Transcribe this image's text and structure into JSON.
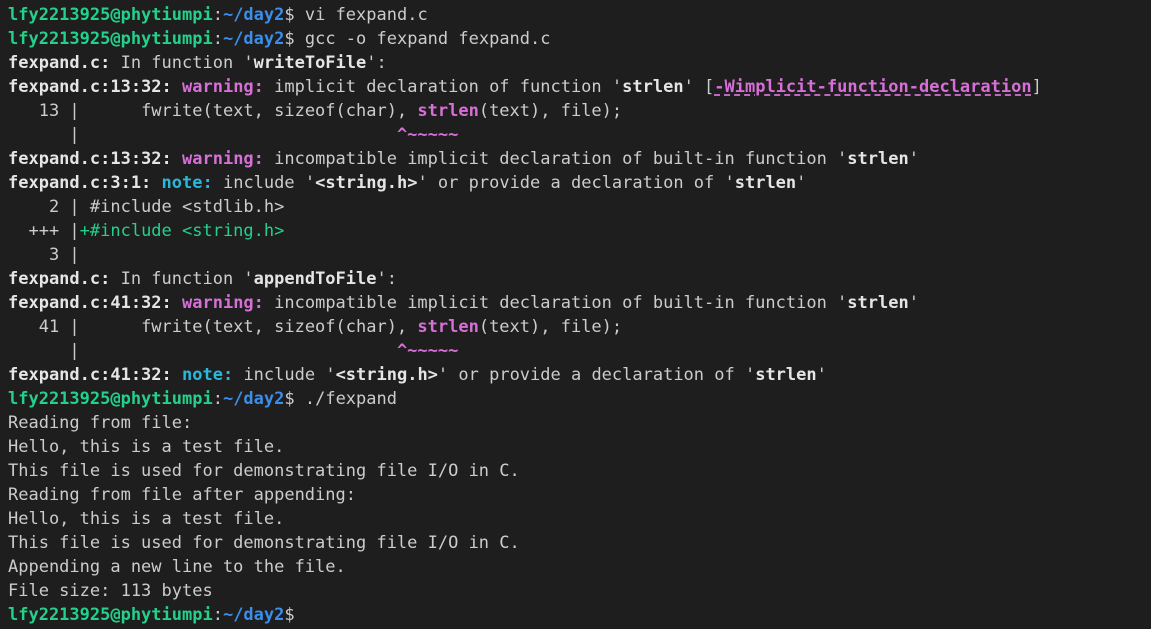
{
  "terminal": {
    "prompt_user_host": "lfy2213925@phytiumpi",
    "prompt_colon": ":",
    "prompt_path": "~/day2",
    "prompt_dollar": "$",
    "cmd1": " vi fexpand.c",
    "cmd2": " gcc -o fexpand fexpand.c",
    "cmd3": " ./fexpand",
    "l3_file": "fexpand.c:",
    "l3_text": " In function '",
    "l3_func": "writeToFile",
    "l3_end": "':",
    "l4_loc": "fexpand.c:13:32:",
    "l4_sp": " ",
    "l4_kind": "warning:",
    "l4_text": " implicit declaration of function '",
    "l4_sym": "strlen",
    "l4_mid": "' [",
    "l4_flag": "-Wimplicit-function-declaration",
    "l4_end": "]",
    "l5_gutter": "   13 |     ",
    "l5_code_a": " fwrite(text, sizeof(char), ",
    "l5_code_sym": "strlen",
    "l5_code_b": "(text), file);",
    "l6_gutter": "      |",
    "l6_pad": "                               ",
    "l6_caret": "^~~~~~",
    "l7_loc": "fexpand.c:13:32:",
    "l7_sp": " ",
    "l7_kind": "warning:",
    "l7_text": " incompatible implicit declaration of built-in function '",
    "l7_sym": "strlen",
    "l7_end": "'",
    "l8_loc": "fexpand.c:3:1:",
    "l8_sp": " ",
    "l8_kind": "note:",
    "l8_text": " include '",
    "l8_hdr": "<string.h>",
    "l8_mid": "' or provide a declaration of '",
    "l8_sym": "strlen",
    "l8_end": "'",
    "l9": "    2 | #include <stdlib.h>",
    "l10_gutter": "  +++ |",
    "l10_fix": "+#include <string.h>",
    "l11": "    3 |",
    "l12_file": "fexpand.c:",
    "l12_text": " In function '",
    "l12_func": "appendToFile",
    "l12_end": "':",
    "l13_loc": "fexpand.c:41:32:",
    "l13_sp": " ",
    "l13_kind": "warning:",
    "l13_text": " incompatible implicit declaration of built-in function '",
    "l13_sym": "strlen",
    "l13_end": "'",
    "l14_gutter": "   41 |     ",
    "l14_code_a": " fwrite(text, sizeof(char), ",
    "l14_code_sym": "strlen",
    "l14_code_b": "(text), file);",
    "l15_gutter": "      |",
    "l15_pad": "                               ",
    "l15_caret": "^~~~~~",
    "l16_loc": "fexpand.c:41:32:",
    "l16_sp": " ",
    "l16_kind": "note:",
    "l16_text": " include '",
    "l16_hdr": "<string.h>",
    "l16_mid": "' or provide a declaration of '",
    "l16_sym": "strlen",
    "l16_end": "'",
    "out1": "Reading from file:",
    "out2": "Hello, this is a test file.",
    "out3": "This file is used for demonstrating file I/O in C.",
    "out4": "Reading from file after appending:",
    "out5": "Hello, this is a test file.",
    "out6": "This file is used for demonstrating file I/O in C.",
    "out7": "Appending a new line to the file.",
    "out8": "File size: 113 bytes"
  },
  "colors": {
    "background": "#1e1e1e",
    "foreground": "#cccccc",
    "prompt_user": "#23d18b",
    "prompt_path": "#3b8eea",
    "warning": "#d670d6",
    "note": "#29b8db",
    "fixit": "#23d18b"
  }
}
